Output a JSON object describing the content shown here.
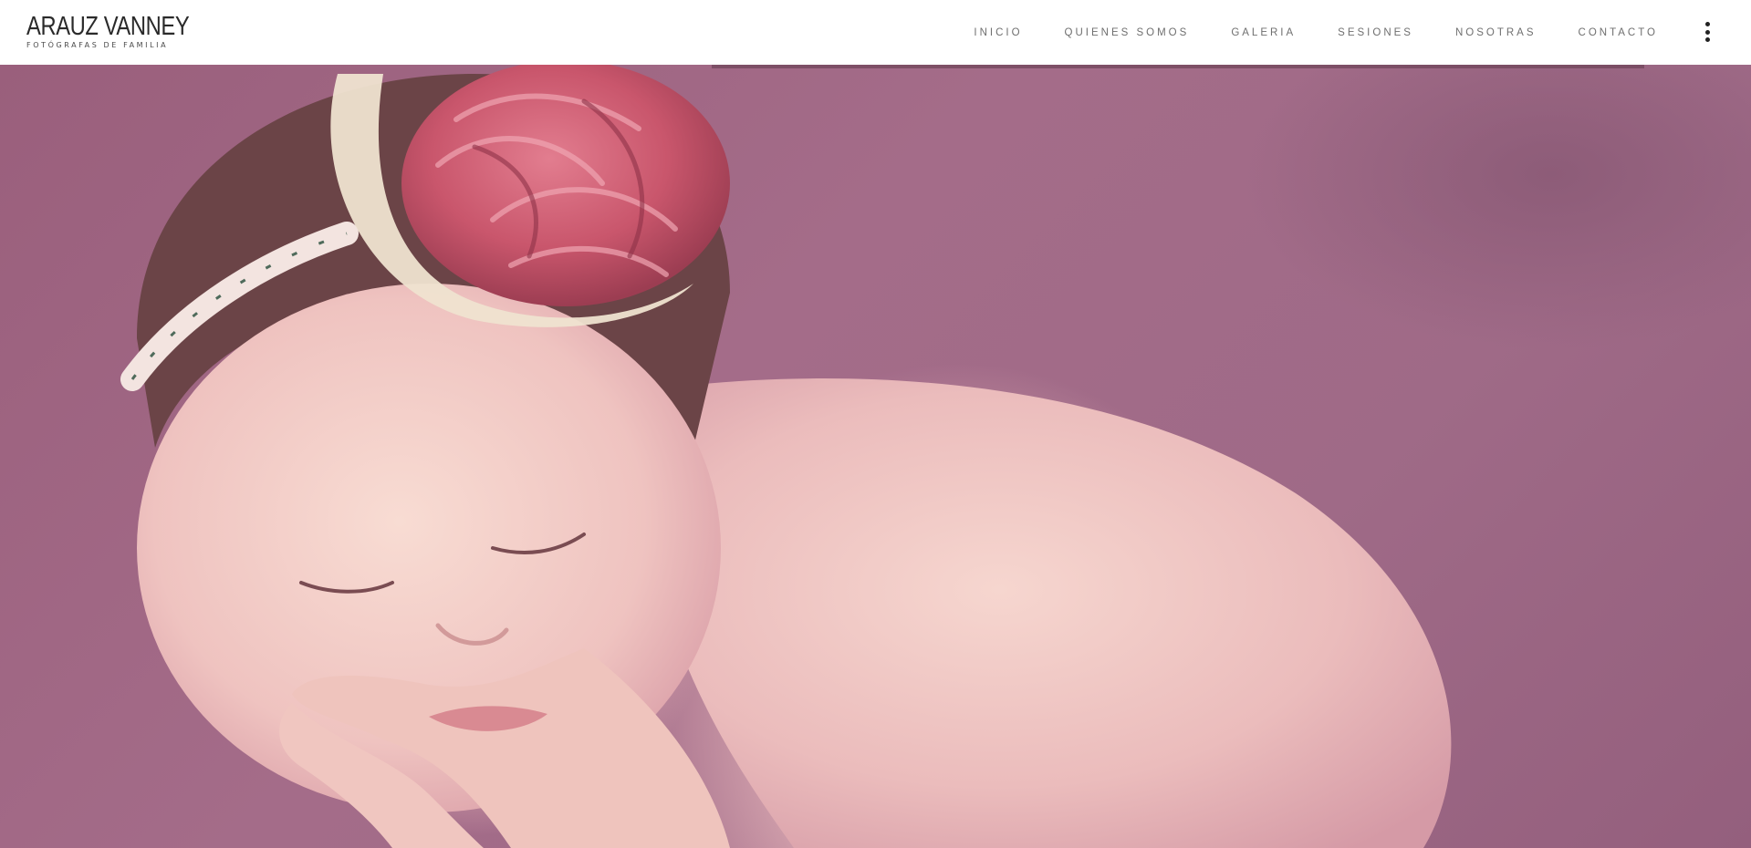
{
  "brand": {
    "title": "ARAUZ VANNEY",
    "subtitle": "FOTÓGRAFAS DE FAMILIA"
  },
  "nav": {
    "items": [
      {
        "label": "INICIO"
      },
      {
        "label": "QUIENES SOMOS"
      },
      {
        "label": "GALERIA"
      },
      {
        "label": "SESIONES"
      },
      {
        "label": "NOSOTRAS"
      },
      {
        "label": "CONTACTO"
      }
    ],
    "menu_icon": "vertical-dots-icon"
  },
  "hero": {
    "image": "sleeping-newborn-with-flower-headband",
    "background_color": "#a06a88"
  },
  "colors": {
    "header_bg": "#ffffff",
    "nav_text": "#6f6f6f",
    "logo_text": "#2a2a2a"
  }
}
